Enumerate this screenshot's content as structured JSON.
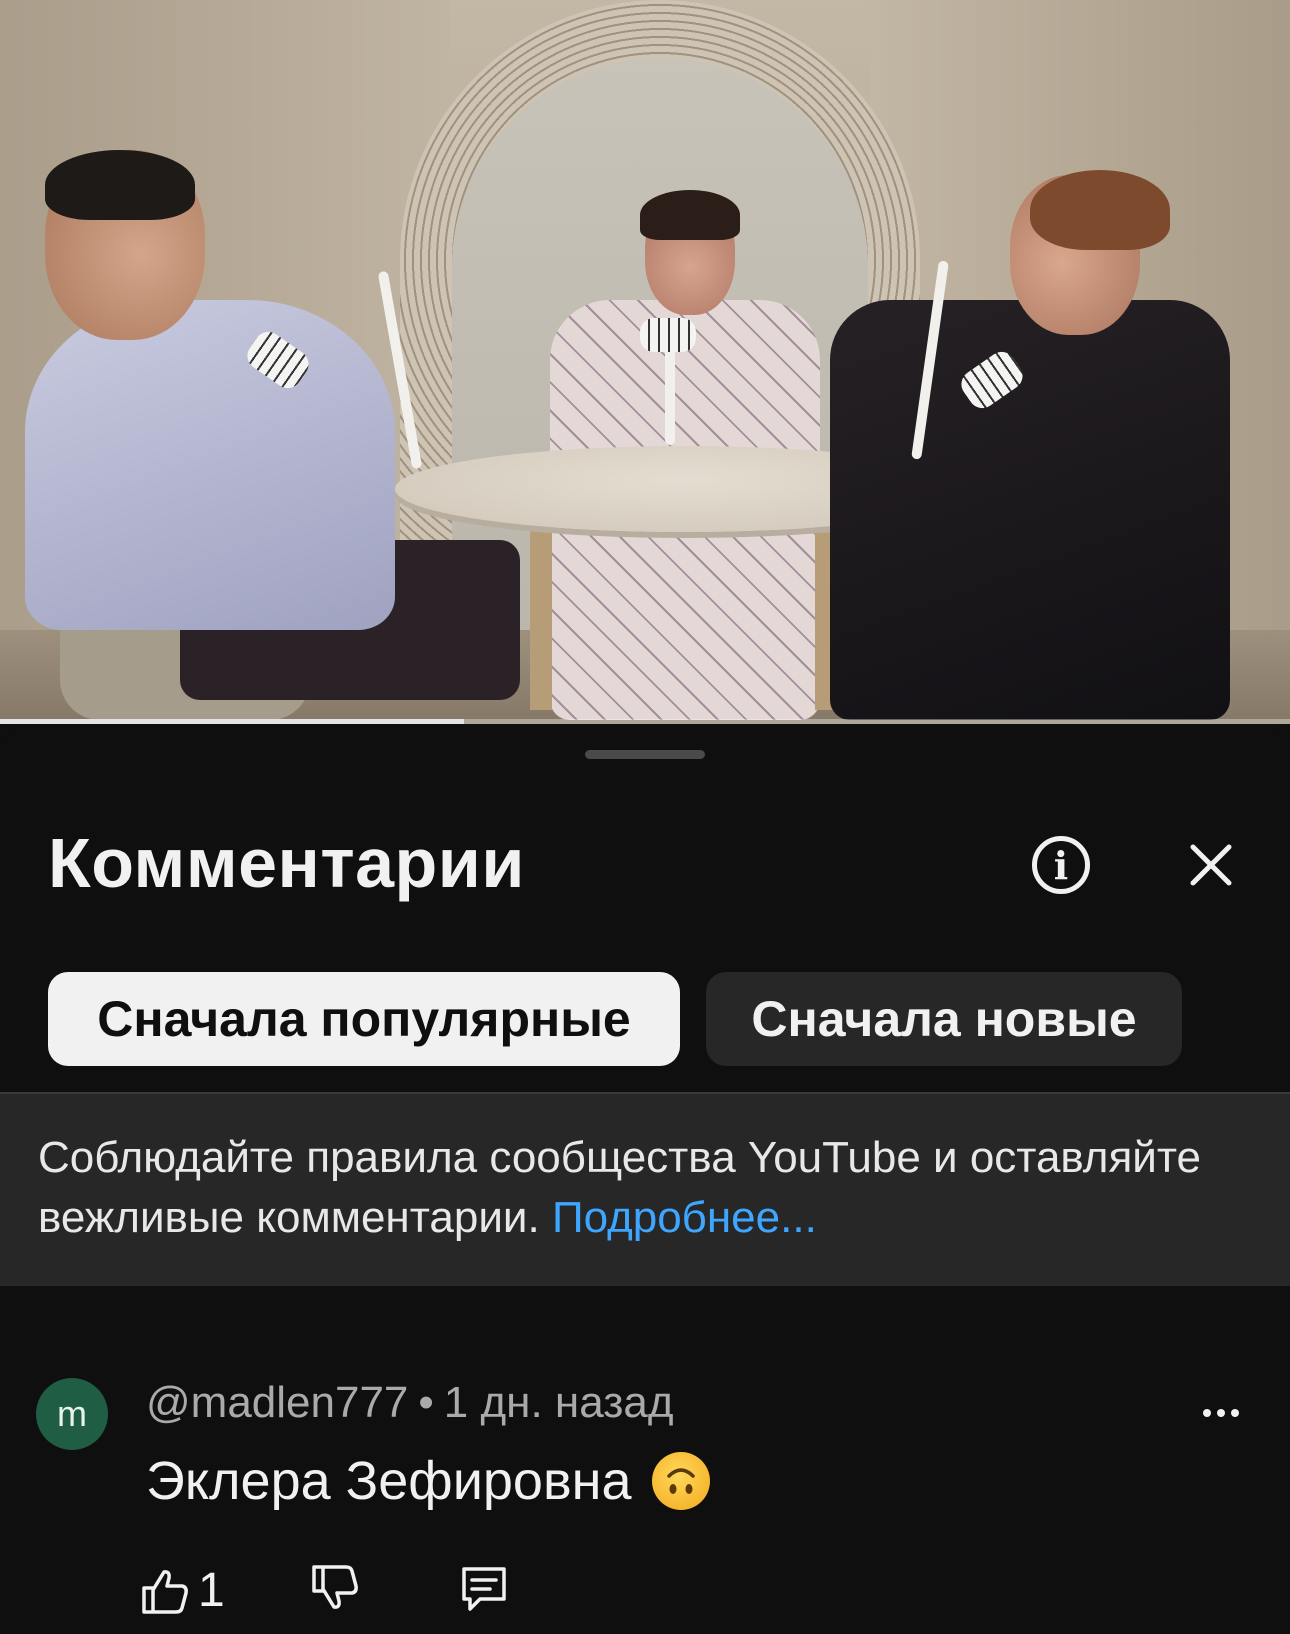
{
  "video": {
    "progress_fraction": 0.36
  },
  "comments_panel": {
    "title": "Комментарии",
    "info_icon": "info-icon",
    "close_icon": "close-icon",
    "sort_chips": [
      {
        "label": "Сначала популярные",
        "selected": true
      },
      {
        "label": "Сначала новые",
        "selected": false
      }
    ],
    "rules_notice": {
      "text": "Соблюдайте правила сообщества YouTube и оставляйте вежливые комментарии.",
      "link": "Подробнее..."
    },
    "comments": [
      {
        "avatar_letter": "m",
        "avatar_color": "#1f5e44",
        "author": "@madlen777",
        "time": "1 дн. назад",
        "text": "Эклера Зефировна",
        "emoji": "upside-down-face-emoji",
        "likes": "1",
        "more_icon": "more-horizontal-icon",
        "like_icon": "thumbs-up-icon",
        "dislike_icon": "thumbs-down-icon",
        "reply_icon": "reply-icon"
      }
    ]
  },
  "colors": {
    "background": "#0f0f0f",
    "chip_selected": "#f1f1f1",
    "chip_unselected": "#272727",
    "link": "#3ea6ff"
  }
}
